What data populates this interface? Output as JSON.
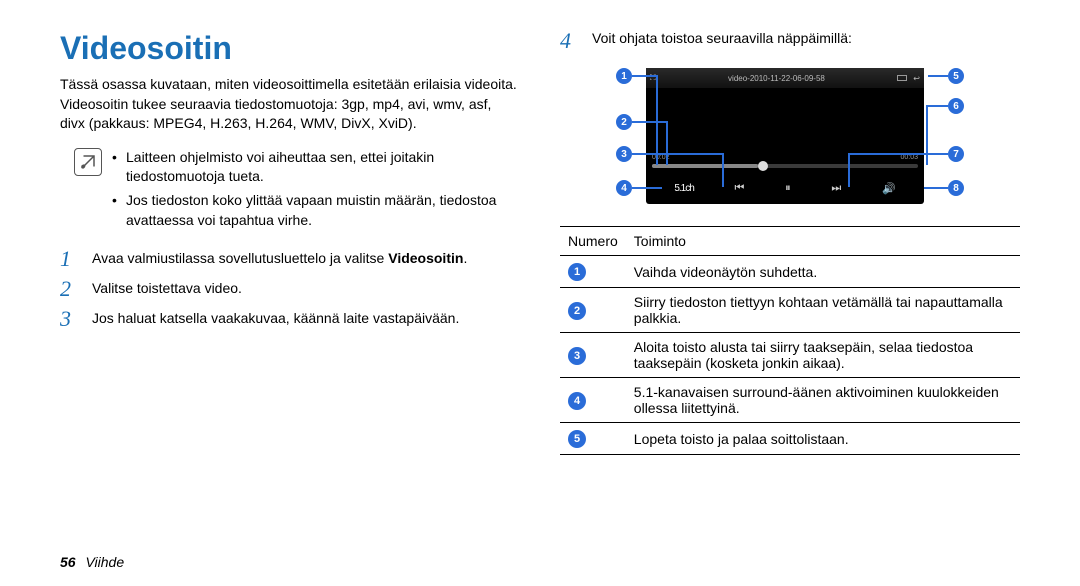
{
  "title": "Videosoitin",
  "intro": "Tässä osassa kuvataan, miten videosoittimella esitetään erilaisia videoita. Videosoitin tukee seuraavia tiedostomuotoja: 3gp, mp4, avi, wmv, asf, divx (pakkaus: MPEG4, H.263, H.264, WMV, DivX, XviD).",
  "notes": [
    "Laitteen ohjelmisto voi aiheuttaa sen, ettei joitakin tiedostomuotoja tueta.",
    "Jos tiedoston koko ylittää vapaan muistin määrän, tiedostoa avattaessa voi tapahtua virhe."
  ],
  "steps": {
    "s1a": "Avaa valmiustilassa sovellutusluettelo ja valitse ",
    "s1b": "Videosoitin",
    "s1c": ".",
    "s2": "Valitse toistettava video.",
    "s3": "Jos haluat katsella vaakakuvaa, käännä laite vastapäivään.",
    "s4": "Voit ohjata toistoa seuraavilla näppäimillä:"
  },
  "callouts": {
    "n1": "1",
    "n2": "2",
    "n3": "3",
    "n4": "4",
    "n5": "5",
    "n6": "6",
    "n7": "7",
    "n8": "8"
  },
  "player": {
    "video_title": "video-2010-11-22-06-09-58",
    "time_l": "00:02",
    "time_r": "00:03",
    "surround_label": "5.1ch",
    "prev_icon": "⏮",
    "pause_icon": "⏸",
    "next_icon": "⏭",
    "volume_icon": "🔊"
  },
  "table": {
    "head_num": "Numero",
    "head_func": "Toiminto",
    "rows": [
      {
        "n": "1",
        "t": "Vaihda videonäytön suhdetta."
      },
      {
        "n": "2",
        "t": "Siirry tiedoston tiettyyn kohtaan vetämällä tai napauttamalla palkkia."
      },
      {
        "n": "3",
        "t": "Aloita toisto alusta tai siirry taaksepäin, selaa tiedostoa taaksepäin (kosketa jonkin aikaa)."
      },
      {
        "n": "4",
        "t": "5.1-kanavaisen surround-äänen aktivoiminen kuulokkeiden ollessa liitettyinä."
      },
      {
        "n": "5",
        "t": "Lopeta toisto ja palaa soittolistaan."
      }
    ]
  },
  "footer": {
    "page": "56",
    "section": "Viihde"
  }
}
